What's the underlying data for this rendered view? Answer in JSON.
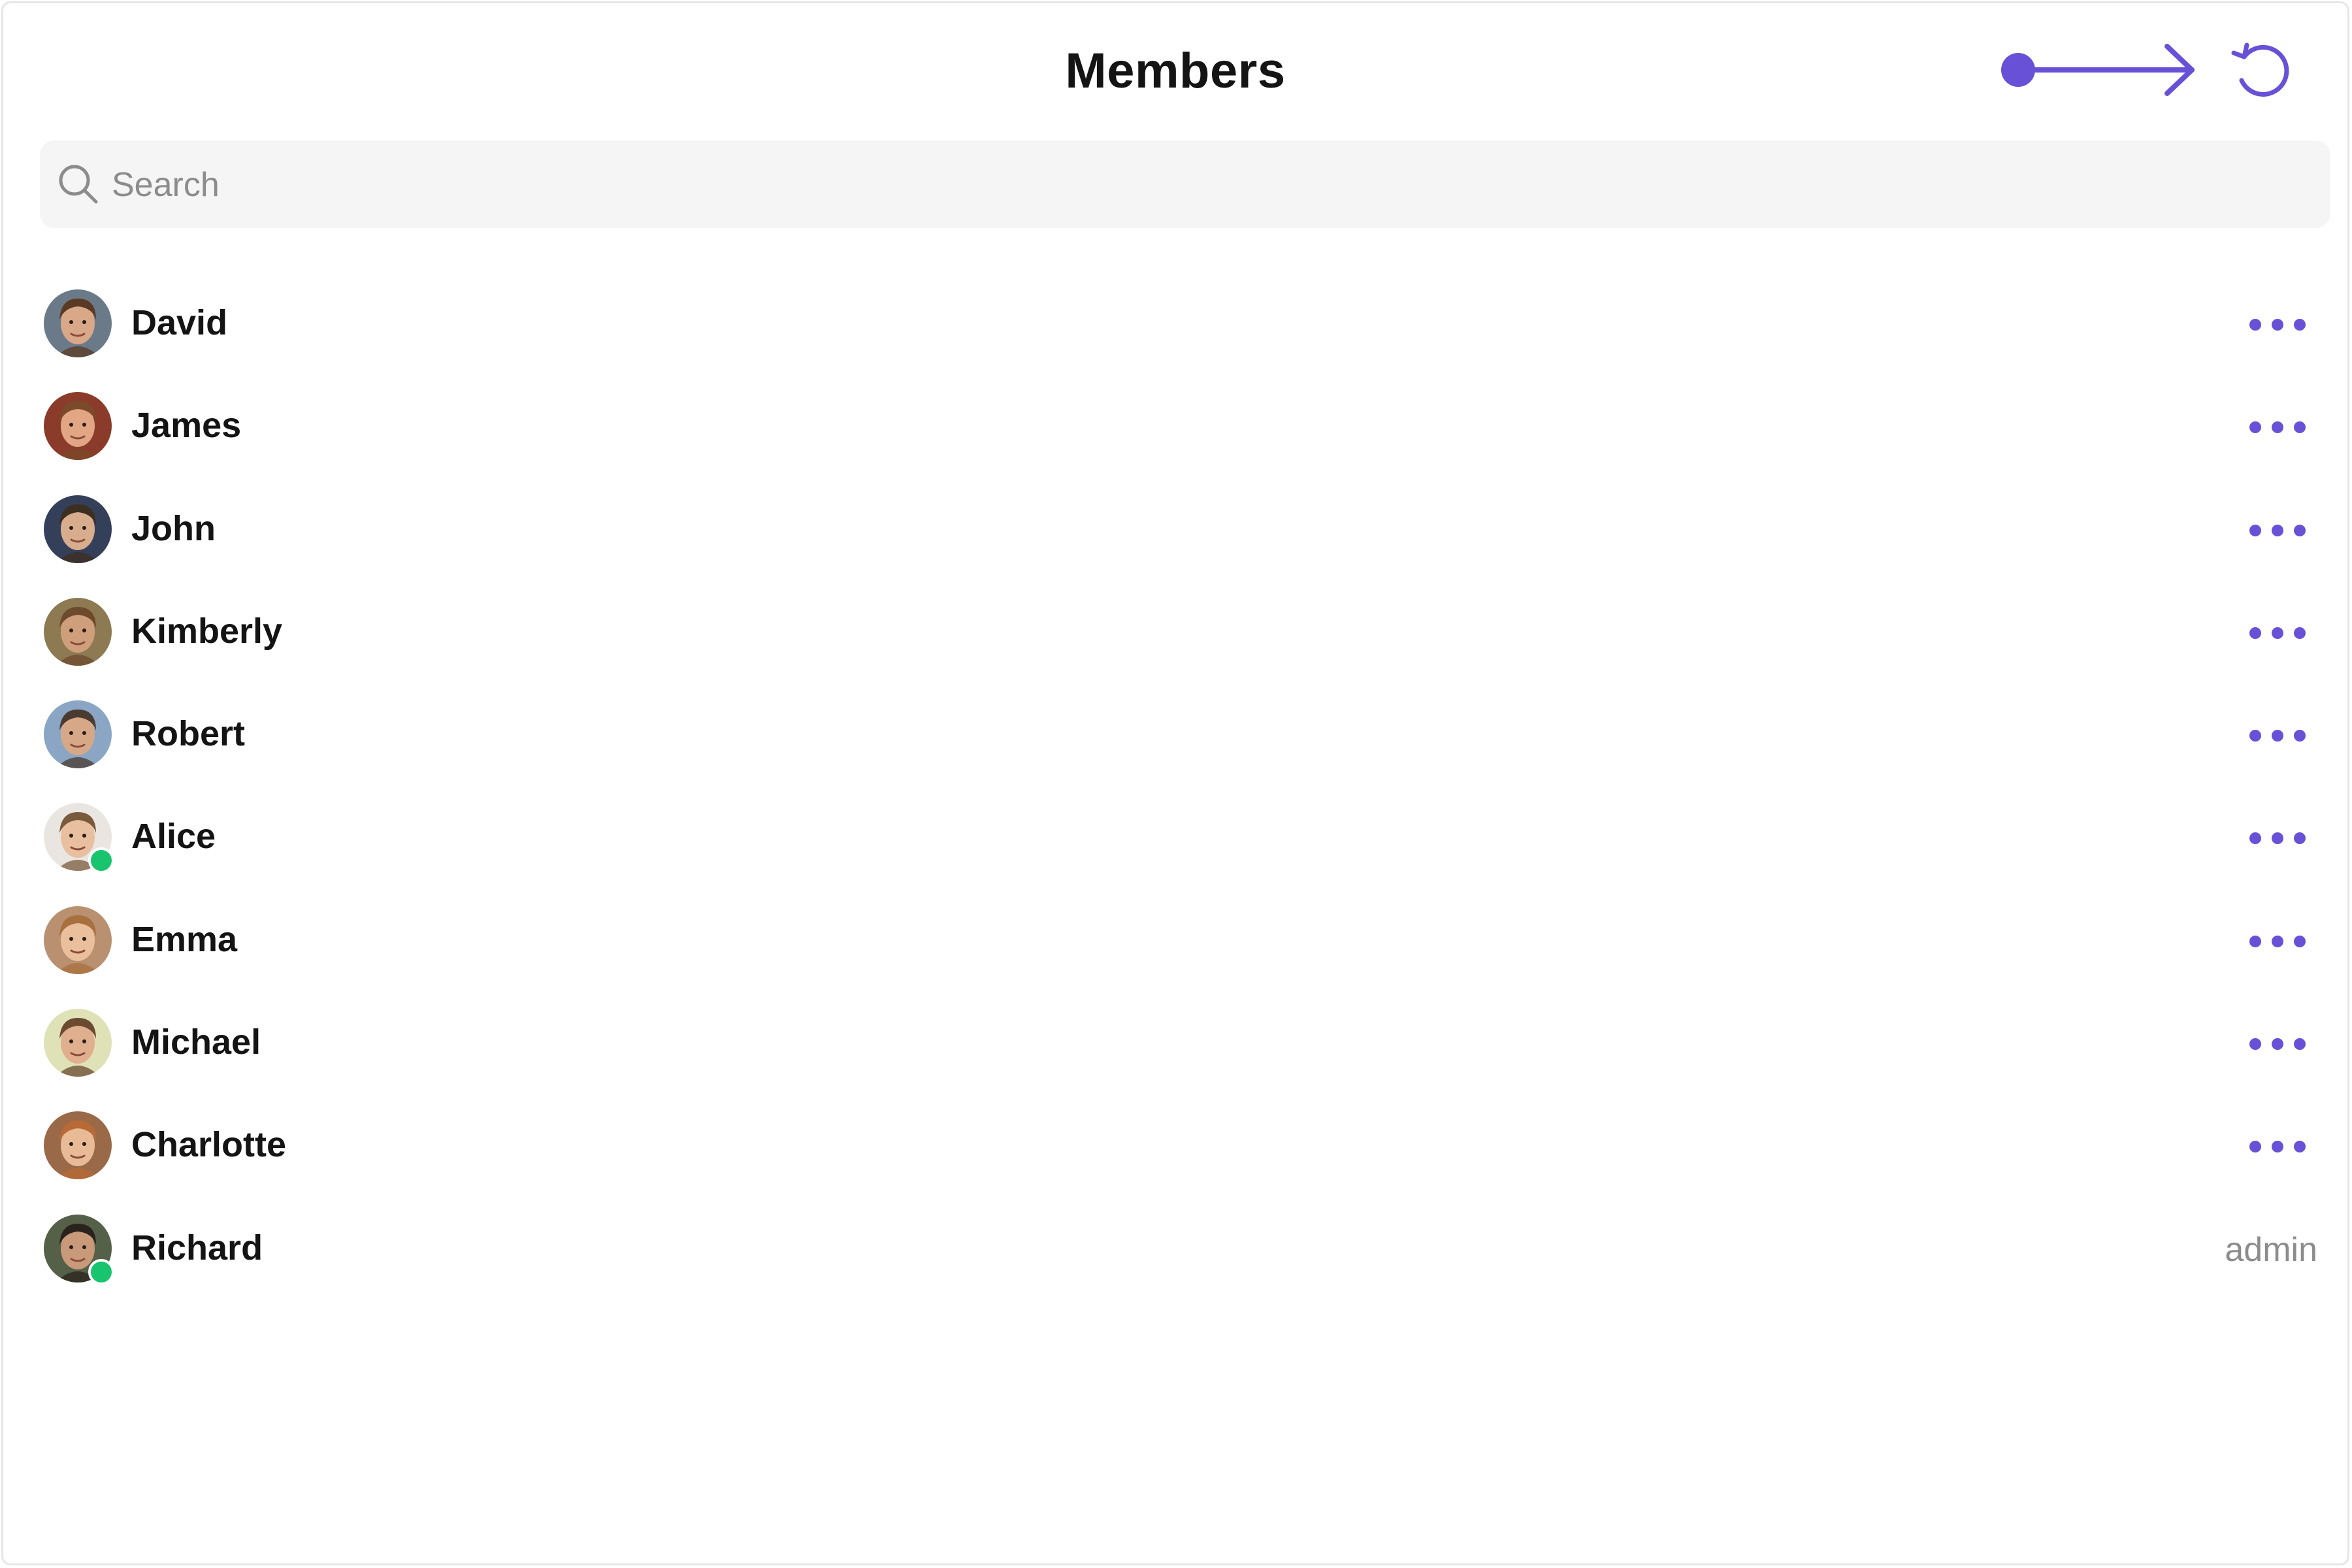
{
  "header": {
    "title": "Members",
    "back_icon": "arrow-right-icon",
    "refresh_icon": "refresh-icon",
    "accent_color": "#6851d6"
  },
  "search": {
    "placeholder": "Search",
    "value": "",
    "icon": "search-icon"
  },
  "members": [
    {
      "name": "David",
      "online": false,
      "action": "more-options",
      "avatar_colors": {
        "bg": "#6b7a88",
        "skin": "#d9a888",
        "hair": "#5a3a24"
      }
    },
    {
      "name": "James",
      "online": false,
      "action": "more-options",
      "avatar_colors": {
        "bg": "#8a3b2a",
        "skin": "#e2a684",
        "hair": "#7a4a2a"
      }
    },
    {
      "name": "John",
      "online": false,
      "action": "more-options",
      "avatar_colors": {
        "bg": "#34405a",
        "skin": "#d8ad8e",
        "hair": "#3d2e22"
      }
    },
    {
      "name": "Kimberly",
      "online": false,
      "action": "more-options",
      "avatar_colors": {
        "bg": "#8d7a52",
        "skin": "#cf9f7c",
        "hair": "#6e4a2c"
      }
    },
    {
      "name": "Robert",
      "online": false,
      "action": "more-options",
      "avatar_colors": {
        "bg": "#8aa6c4",
        "skin": "#d6a888",
        "hair": "#4a3a30"
      }
    },
    {
      "name": "Alice",
      "online": true,
      "action": "more-options",
      "avatar_colors": {
        "bg": "#e9e6e2",
        "skin": "#e8c0a0",
        "hair": "#7a5a3c"
      }
    },
    {
      "name": "Emma",
      "online": false,
      "action": "more-options",
      "avatar_colors": {
        "bg": "#b99070",
        "skin": "#eabf9c",
        "hair": "#a8703e"
      }
    },
    {
      "name": "Michael",
      "online": false,
      "action": "more-options",
      "avatar_colors": {
        "bg": "#dfe2b6",
        "skin": "#e0b08e",
        "hair": "#6a4a30"
      }
    },
    {
      "name": "Charlotte",
      "online": false,
      "action": "more-options",
      "avatar_colors": {
        "bg": "#9a6a48",
        "skin": "#e8bb96",
        "hair": "#b86a36"
      }
    },
    {
      "name": "Richard",
      "online": true,
      "action": "role",
      "role": "admin",
      "avatar_colors": {
        "bg": "#556048",
        "skin": "#c89a7a",
        "hair": "#2a221c"
      }
    }
  ],
  "colors": {
    "online": "#19c46e",
    "text": "#141414",
    "muted": "#8c8c8c",
    "search_bg": "#f5f5f5"
  }
}
